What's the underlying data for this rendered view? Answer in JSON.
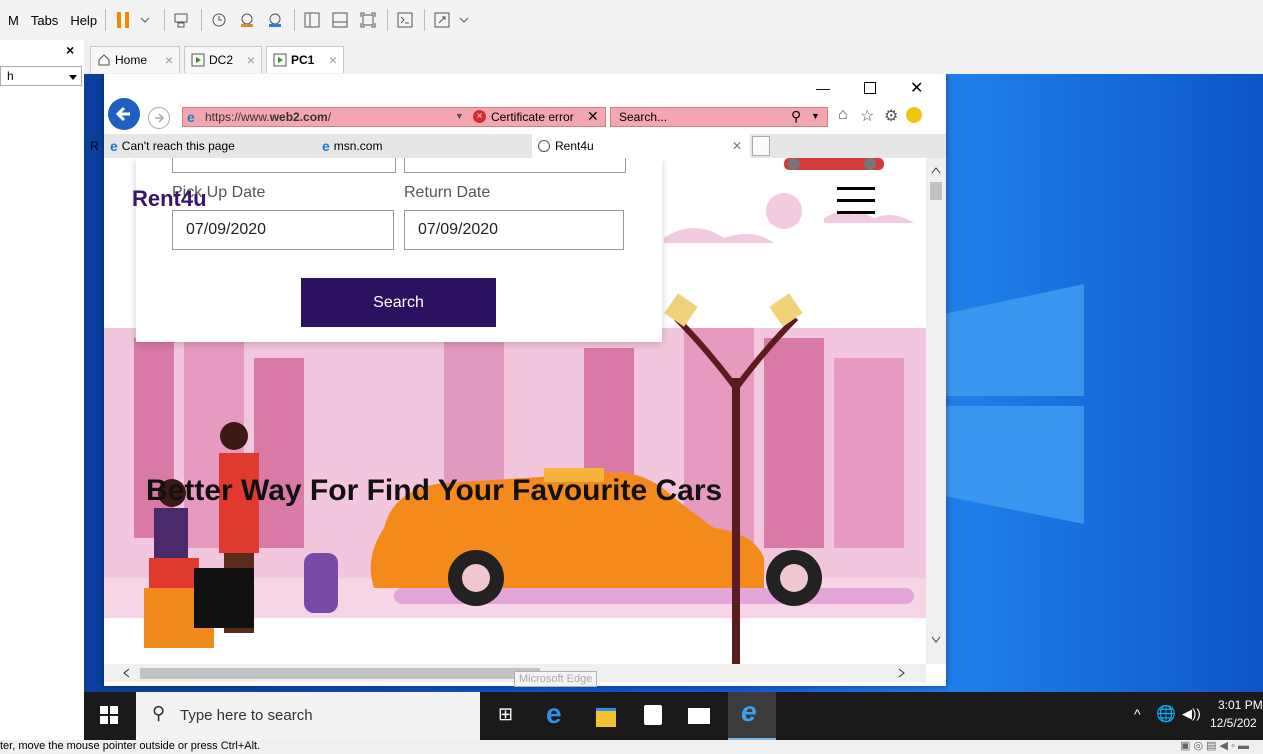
{
  "vmware": {
    "menu": [
      "M",
      "Tabs",
      "Help"
    ],
    "status_hint": "ter, move the mouse pointer outside or press Ctrl+Alt.",
    "library_search": "h"
  },
  "vm_tabs": [
    {
      "label": "Home",
      "active": false
    },
    {
      "label": "DC2",
      "active": false
    },
    {
      "label": "PC1",
      "active": true
    }
  ],
  "ie": {
    "address": "https://www.web2.com/",
    "address_prefix": "https://www.",
    "address_domain": "web2.com",
    "address_suffix": "/",
    "cert_error": "Certificate error",
    "search_placeholder": "Search...",
    "tabs": [
      {
        "label": "Can't reach this page",
        "active": false
      },
      {
        "label": "msn.com",
        "active": false
      },
      {
        "label": "Rent4u",
        "active": true
      }
    ],
    "tab_prefix": "R"
  },
  "site": {
    "brand": "Rent4u",
    "pickup_label": "Pick Up Date",
    "return_label": "Return Date",
    "pickup_value": "07/09/2020",
    "return_value": "07/09/2020",
    "search_button": "Search",
    "headline": "Better Way For Find Your Favourite Cars",
    "accent": "#2b1260"
  },
  "taskbar": {
    "search_placeholder": "Type here to search",
    "tooltip": "Microsoft Edge",
    "time": "3:01 PM",
    "date": "12/5/202"
  }
}
